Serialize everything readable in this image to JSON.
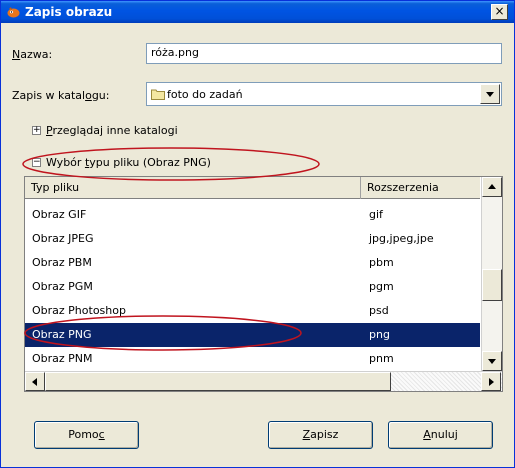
{
  "window": {
    "title": "Zapis obrazu",
    "close_glyph": "×",
    "title_icon": "gimp-icon"
  },
  "form": {
    "name_label_pre": "",
    "name_label_ul": "N",
    "name_label_post": "azwa:",
    "name_value": "róża.png",
    "folder_label_pre": "Zapis w katal",
    "folder_label_ul": "o",
    "folder_label_post": "gu:",
    "folder_value": "foto do zadań",
    "folder_icon": "folder-icon"
  },
  "browse": {
    "expander": "+",
    "label_pre": "",
    "label_ul": "P",
    "label_post": "rzeglądaj inne katalogi"
  },
  "filetype": {
    "expander": "−",
    "label_pre": "Wybór ",
    "label_ul": "t",
    "label_post": "ypu pliku (Obraz PNG)"
  },
  "table": {
    "columns": [
      "Typ pliku",
      "Rozszerzenia"
    ],
    "rows": [
      {
        "type": "Obraz GIF",
        "ext": "gif"
      },
      {
        "type": "Obraz JPEG",
        "ext": "jpg,jpeg,jpe"
      },
      {
        "type": "Obraz PBM",
        "ext": "pbm"
      },
      {
        "type": "Obraz PGM",
        "ext": "pgm"
      },
      {
        "type": "Obraz Photoshop",
        "ext": "psd"
      },
      {
        "type": "Obraz PNG",
        "ext": "png",
        "selected": true
      },
      {
        "type": "Obraz PNM",
        "ext": "pnm"
      }
    ]
  },
  "buttons": {
    "help_pre": "Pomo",
    "help_ul": "c",
    "help_post": "",
    "save_pre": "",
    "save_ul": "Z",
    "save_post": "apisz",
    "cancel_pre": "",
    "cancel_ul": "A",
    "cancel_post": "nuluj"
  },
  "colors": {
    "titlebar": "#0054e3",
    "selection": "#0a246a",
    "annotation": "#c0141e",
    "face": "#ece9d8"
  }
}
